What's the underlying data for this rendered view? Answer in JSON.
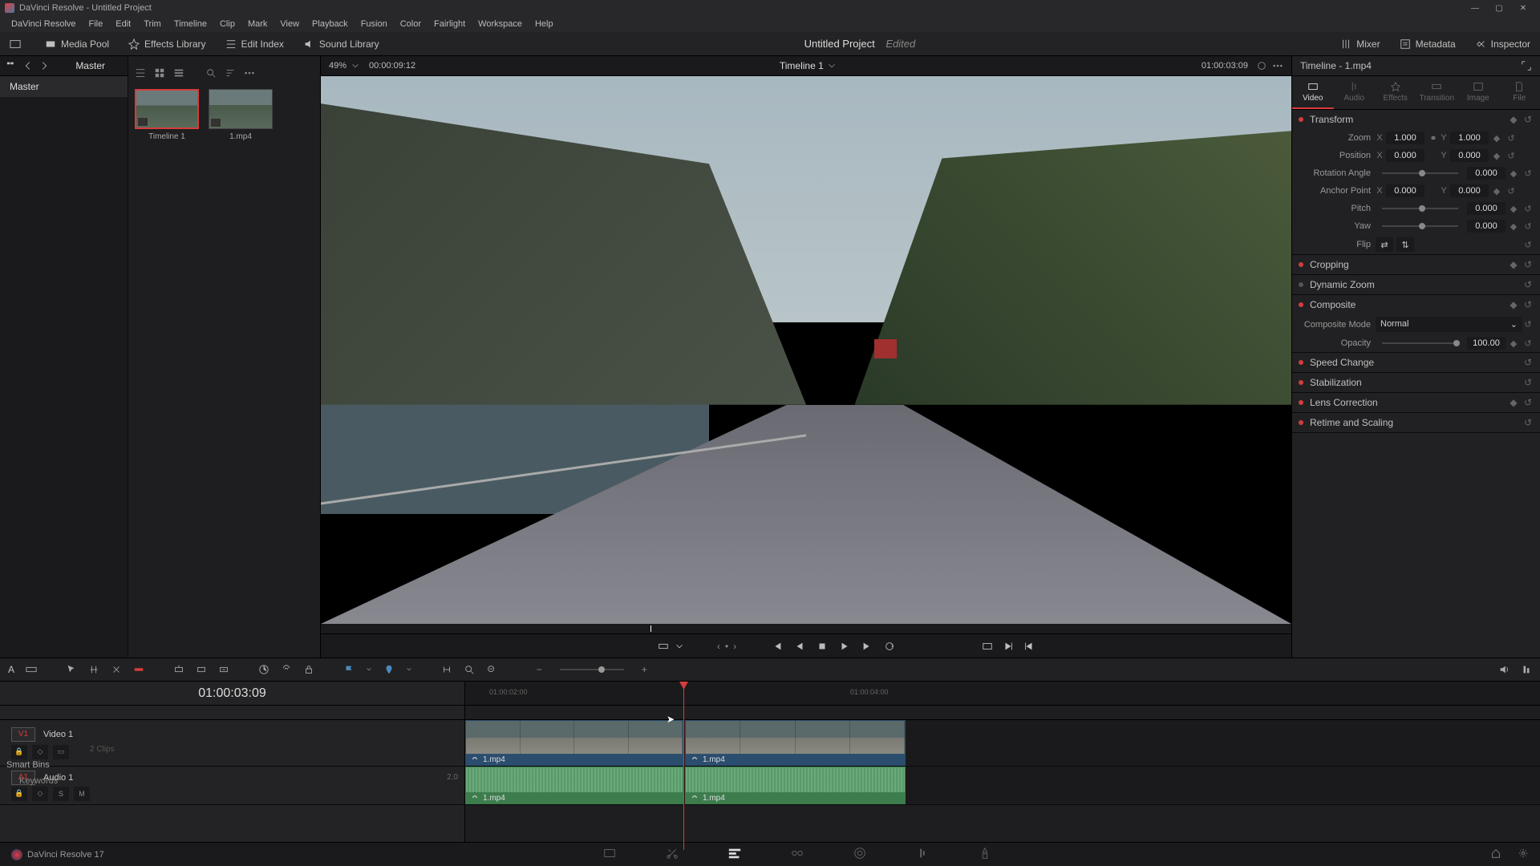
{
  "window": {
    "title": "DaVinci Resolve - Untitled Project"
  },
  "menus": [
    "DaVinci Resolve",
    "File",
    "Edit",
    "Trim",
    "Timeline",
    "Clip",
    "Mark",
    "View",
    "Playback",
    "Fusion",
    "Color",
    "Fairlight",
    "Workspace",
    "Help"
  ],
  "toolbar": {
    "media_pool": "Media Pool",
    "effects_library": "Effects Library",
    "edit_index": "Edit Index",
    "sound_library": "Sound Library",
    "mixer": "Mixer",
    "metadata": "Metadata",
    "inspector": "Inspector",
    "project_title": "Untitled Project",
    "edited": "Edited"
  },
  "media": {
    "master": "Master",
    "master_folder": "Master",
    "smart_bins": "Smart Bins",
    "keywords": "Keywords",
    "thumbs": [
      {
        "name": "Timeline 1",
        "type": "timeline"
      },
      {
        "name": "1.mp4",
        "type": "clip"
      }
    ]
  },
  "viewer": {
    "zoom": "49%",
    "tc_left": "00:00:09:12",
    "title": "Timeline 1",
    "tc_right": "01:00:03:09"
  },
  "inspector": {
    "title": "Timeline - 1.mp4",
    "tabs": [
      "Video",
      "Audio",
      "Effects",
      "Transition",
      "Image",
      "File"
    ],
    "transform": {
      "label": "Transform",
      "zoom_label": "Zoom",
      "zoom_x": "1.000",
      "zoom_y": "1.000",
      "position_label": "Position",
      "pos_x": "0.000",
      "pos_y": "0.000",
      "rotation_label": "Rotation Angle",
      "rotation": "0.000",
      "anchor_label": "Anchor Point",
      "anchor_x": "0.000",
      "anchor_y": "0.000",
      "pitch_label": "Pitch",
      "pitch": "0.000",
      "yaw_label": "Yaw",
      "yaw": "0.000",
      "flip_label": "Flip"
    },
    "cropping": "Cropping",
    "dynamic_zoom": "Dynamic Zoom",
    "composite": {
      "label": "Composite",
      "mode_label": "Composite Mode",
      "mode": "Normal",
      "opacity_label": "Opacity",
      "opacity": "100.00"
    },
    "speed_change": "Speed Change",
    "stabilization": "Stabilization",
    "lens_correction": "Lens Correction",
    "retime": "Retime and Scaling"
  },
  "timeline": {
    "timecode": "01:00:03:09",
    "v1_tag": "V1",
    "v1_name": "Video 1",
    "a1_tag": "A1",
    "a1_name": "Audio 1",
    "a1_ch": "2.0",
    "clips": "2 Clips",
    "clip_name": "1.mp4",
    "ruler_tc1": "01:00:02:00",
    "ruler_tc2": "01:00:04:00"
  },
  "footer": {
    "app": "DaVinci Resolve 17"
  }
}
